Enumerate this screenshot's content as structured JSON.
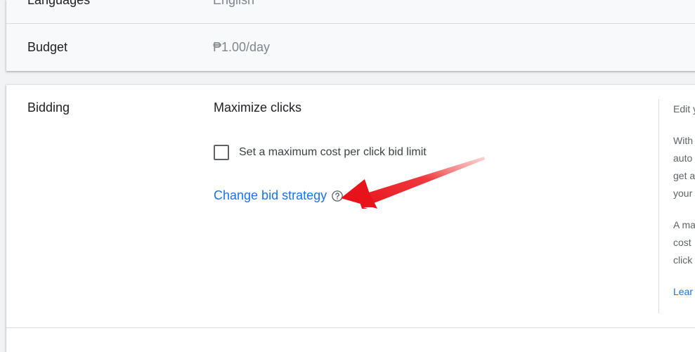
{
  "summary": {
    "languages": {
      "label": "Languages",
      "value": "English"
    },
    "budget": {
      "label": "Budget",
      "value": "₱1.00/day"
    }
  },
  "bidding": {
    "label": "Bidding",
    "strategy": "Maximize clicks",
    "max_cpc_checkbox_label": "Set a maximum cost per click bid limit",
    "max_cpc_checked": false,
    "change_link": "Change bid strategy"
  },
  "side_panel": {
    "lines": [
      "Edit y",
      "With",
      "auto",
      "get a",
      "your",
      "A ma",
      "cost",
      "click"
    ],
    "link": "Lear"
  },
  "annotation": {
    "arrow_color": "#e8121a"
  }
}
